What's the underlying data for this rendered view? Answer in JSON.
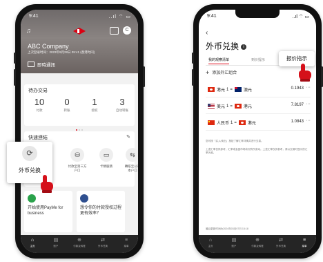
{
  "left": {
    "status": {
      "time": "9:41",
      "signal": "..ıl ⌔ ▭"
    },
    "header": {
      "company": "ABC Company",
      "last_login": "上次登录时间：2023年9月28日 09:41 (香港时间)",
      "notify_label": "即時通訊",
      "avatar_letter": "C"
    },
    "tasks": {
      "title": "待办交易",
      "items": [
        {
          "count": "10",
          "label": "付款"
        },
        {
          "count": "0",
          "label": "转账"
        },
        {
          "count": "1",
          "label": "授权"
        },
        {
          "count": "3",
          "label": "自动转账"
        }
      ]
    },
    "quick": {
      "title": "快速連結",
      "items": [
        {
          "label": "付款至第三方\n户口"
        },
        {
          "label": "卡類服務"
        },
        {
          "label": "轉賬至公司\n本户口"
        }
      ]
    },
    "callout": {
      "label": "外币兑换"
    },
    "promos": [
      {
        "text": "开始使用PayMe for business",
        "color": "#2aa24b"
      },
      {
        "text": "想令你的付款授权过程更有效率？",
        "color": "#2f4f8f"
      }
    ],
    "tabbar": [
      {
        "label": "主页",
        "icon": "⌂"
      },
      {
        "label": "账户",
        "icon": "▤"
      },
      {
        "label": "付款及转账",
        "icon": "⊕"
      },
      {
        "label": "外币兑换",
        "icon": "⇄"
      },
      {
        "label": "菜单",
        "icon": "≡"
      }
    ]
  },
  "right": {
    "status": {
      "time": "9:41",
      "signal": "..ıl ⌔ ▭"
    },
    "title": "外币兑换",
    "tabs": [
      "我的观察清单",
      "到价提示"
    ],
    "add_label": "添加外汇组合",
    "rows": [
      {
        "from_flag": "hk",
        "from": "港元",
        "qty": "1",
        "to_flag": "au",
        "to": "澳元",
        "rate": "0.1943"
      },
      {
        "from_flag": "us",
        "from": "美元",
        "qty": "1",
        "to_flag": "hk",
        "to": "港元",
        "rate": "7.8197"
      },
      {
        "from_flag": "cn",
        "from": "人民币",
        "qty": "1",
        "to_flag": "hk",
        "to": "港元",
        "rate": "1.0843"
      }
    ],
    "disclaimer_1": "您可按「买入/卖出」按钮了解汇率详情并进行交易。",
    "disclaimer_2": "上述汇率仅供参考，汇率或会因市场状况有所变动。上述汇率仅供参考，请以交易时显示的汇率为准。",
    "footer": "最后更新时间为2024年03月07日 15:18",
    "callout": "报价指示",
    "tabbar": [
      {
        "label": "主页",
        "icon": "⌂"
      },
      {
        "label": "账户",
        "icon": "▤"
      },
      {
        "label": "付款及转账",
        "icon": "⊕"
      },
      {
        "label": "外币兑换",
        "icon": "⇄"
      },
      {
        "label": "菜单",
        "icon": "≡"
      }
    ]
  }
}
